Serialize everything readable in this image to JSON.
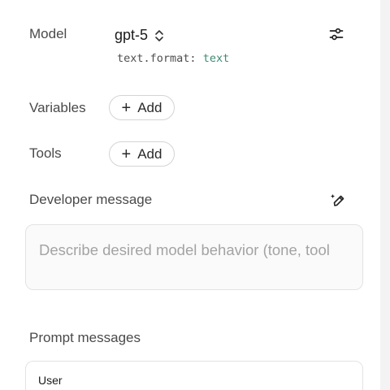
{
  "model": {
    "label": "Model",
    "name": "gpt-5",
    "format_key": "text.format:",
    "format_value": "text",
    "selector_icon": "chevron-up-down-icon",
    "settings_icon": "sliders-icon"
  },
  "variables": {
    "label": "Variables",
    "add_label": "Add"
  },
  "tools": {
    "label": "Tools",
    "add_label": "Add"
  },
  "developer": {
    "label": "Developer message",
    "placeholder": "Describe desired model behavior (tone, tool",
    "edit_icon": "pen-sparkle-icon"
  },
  "prompt_messages": {
    "label": "Prompt messages",
    "first_role": "User"
  },
  "colors": {
    "format_value": "#3d8a73",
    "border": "#d4d4d4",
    "placeholder": "#a3a3a3"
  }
}
